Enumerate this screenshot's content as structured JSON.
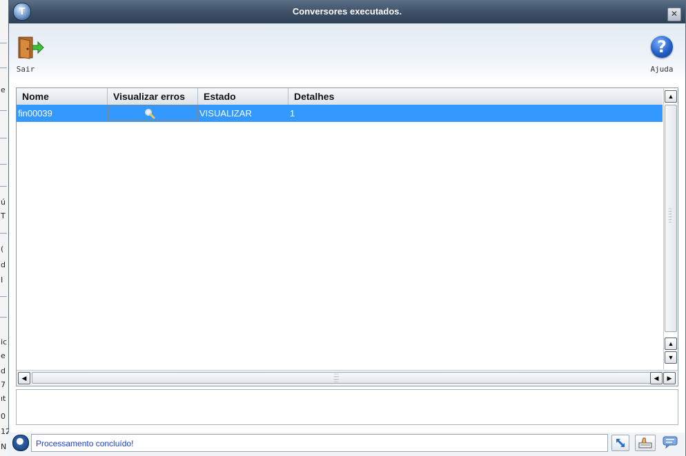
{
  "window": {
    "title": "Conversores executados.",
    "logo_letter": "T"
  },
  "toolbar": {
    "exit_label": "Sair",
    "help_label": "Ajuda",
    "help_glyph": "?"
  },
  "grid": {
    "columns": [
      "Nome",
      "Visualizar erros",
      "Estado",
      "Detalhes"
    ],
    "rows": [
      {
        "nome": "fin00039",
        "visualizar_erros": "search-icon",
        "estado": "VISUALIZAR",
        "detalhes": "1"
      }
    ]
  },
  "status": {
    "message": "Processamento concluído!"
  },
  "background_fragments": [
    "e",
    "ú",
    "T",
    "(",
    "d",
    "I",
    "ic",
    "e",
    "d",
    "7",
    "ıt",
    "0",
    "12",
    "N"
  ],
  "colors": {
    "selection": "#3399ff",
    "titlebar": "#3f5269",
    "status_text": "#1a3fd0"
  }
}
